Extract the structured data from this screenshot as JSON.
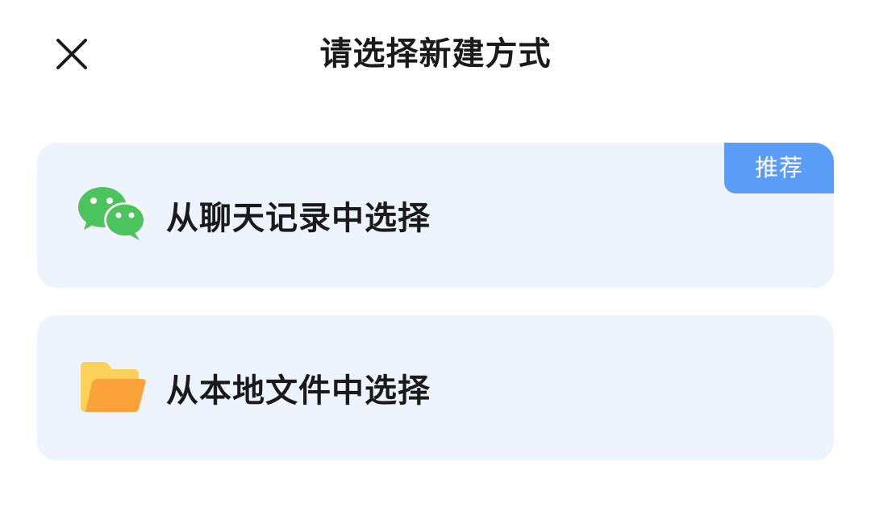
{
  "header": {
    "title": "请选择新建方式",
    "close_icon": "close-icon"
  },
  "options": [
    {
      "label": "从聊天记录中选择",
      "icon": "wechat-icon",
      "badge": "推荐",
      "icon_color": "#4cc45e"
    },
    {
      "label": "从本地文件中选择",
      "icon": "folder-icon",
      "icon_color": "#fbb13c"
    }
  ],
  "colors": {
    "card_background": "#eef4fd",
    "badge_background": "#5a9df6",
    "text": "#1a1a1a"
  }
}
